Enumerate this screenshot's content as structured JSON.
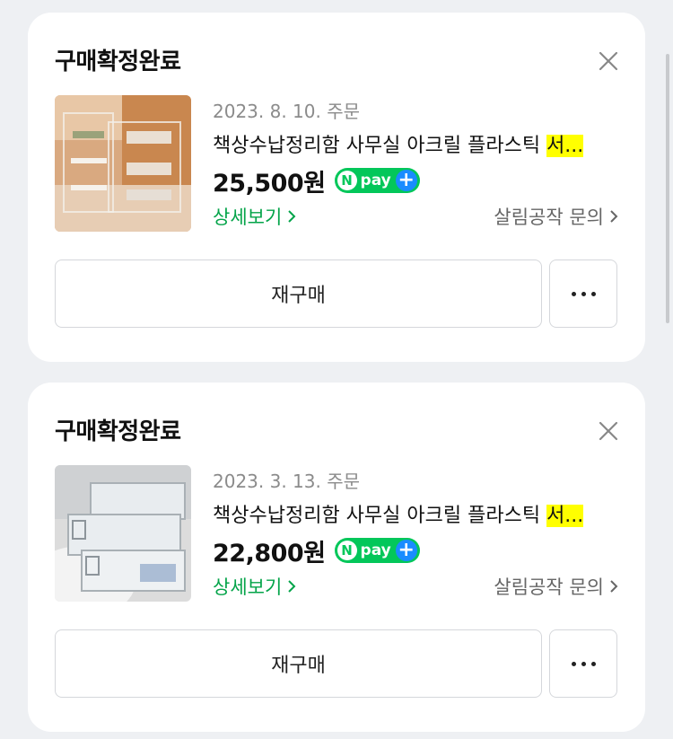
{
  "orders": [
    {
      "status": "구매확정완료",
      "date": "2023. 8. 10. 주문",
      "title_prefix": "책상수납정리함 사무실 아크릴 플라스틱 ",
      "title_highlight": "서...",
      "price": "25,500원",
      "npay": {
        "n": "N",
        "pay": "pay",
        "plus": "+"
      },
      "detail_label": "상세보기",
      "inquiry_label": "살림공작 문의",
      "rebuy_label": "재구매"
    },
    {
      "status": "구매확정완료",
      "date": "2023. 3. 13. 주문",
      "title_prefix": "책상수납정리함 사무실 아크릴 플라스틱 ",
      "title_highlight": "서...",
      "price": "22,800원",
      "npay": {
        "n": "N",
        "pay": "pay",
        "plus": "+"
      },
      "detail_label": "상세보기",
      "inquiry_label": "살림공작 문의",
      "rebuy_label": "재구매"
    }
  ],
  "colors": {
    "accent_green": "#05a44a",
    "npay_green": "#03c75a",
    "npay_blue": "#1a8cff",
    "highlight": "#ffff00"
  },
  "icons": [
    "close-icon",
    "chevron-right-icon",
    "more-dots-icon"
  ]
}
